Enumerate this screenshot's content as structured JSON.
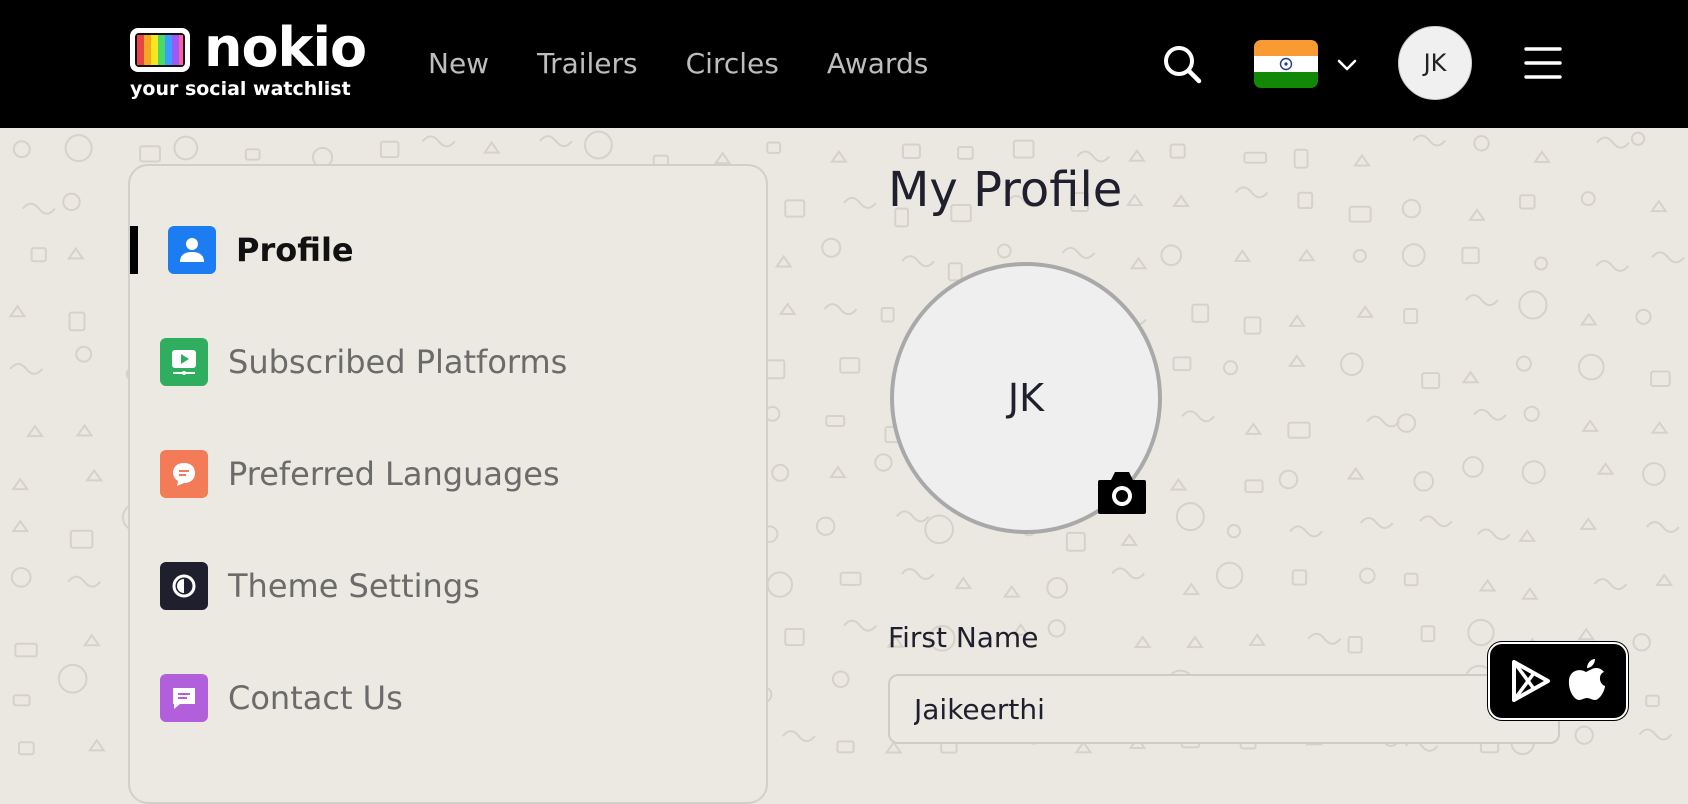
{
  "brand": {
    "name": "nokio",
    "tagline": "your social watchlist"
  },
  "nav": {
    "items": [
      "New",
      "Trailers",
      "Circles",
      "Awards"
    ]
  },
  "header": {
    "user_initials": "JK",
    "country_flag": "india-flag",
    "flag_colors": [
      "#f99b32",
      "#ffffff",
      "#128807"
    ]
  },
  "sidebar": {
    "items": [
      {
        "label": "Profile",
        "icon": "user-icon",
        "color": "#1c7cf2",
        "active": true
      },
      {
        "label": "Subscribed Platforms",
        "icon": "screen-play-icon",
        "color": "#2fae60"
      },
      {
        "label": "Preferred Languages",
        "icon": "chat-bubble-icon",
        "color": "#f47b57"
      },
      {
        "label": "Theme Settings",
        "icon": "theme-toggle-icon",
        "color": "#1f1f2e"
      },
      {
        "label": "Contact Us",
        "icon": "message-icon",
        "color": "#b25fdc"
      }
    ]
  },
  "main": {
    "title": "My Profile",
    "avatar_initials": "JK",
    "first_name_label": "First Name",
    "first_name_value": "Jaikeerthi"
  }
}
